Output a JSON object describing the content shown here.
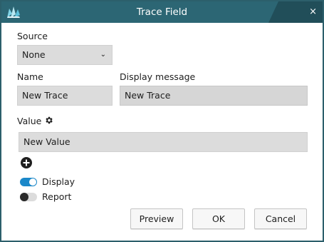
{
  "window": {
    "title": "Trace Field",
    "close_glyph": "×",
    "logo_icon": "app-logo-icon"
  },
  "form": {
    "source": {
      "label": "Source",
      "value": "None",
      "chevron": "⌄"
    },
    "name": {
      "label": "Name",
      "value": "New Trace"
    },
    "display_message": {
      "label": "Display message",
      "value": "New Trace"
    },
    "value": {
      "label": "Value",
      "value": "New Value",
      "settings_icon": "gear-icon",
      "add_icon": "add-circle-icon"
    },
    "toggles": [
      {
        "label": "Display",
        "on": true
      },
      {
        "label": "Report",
        "on": false
      }
    ]
  },
  "buttons": {
    "preview": "Preview",
    "ok": "OK",
    "cancel": "Cancel"
  },
  "colors": {
    "titlebar": "#2c6674",
    "accent": "#1b88c9",
    "field_bg": "#dcdcdc"
  }
}
